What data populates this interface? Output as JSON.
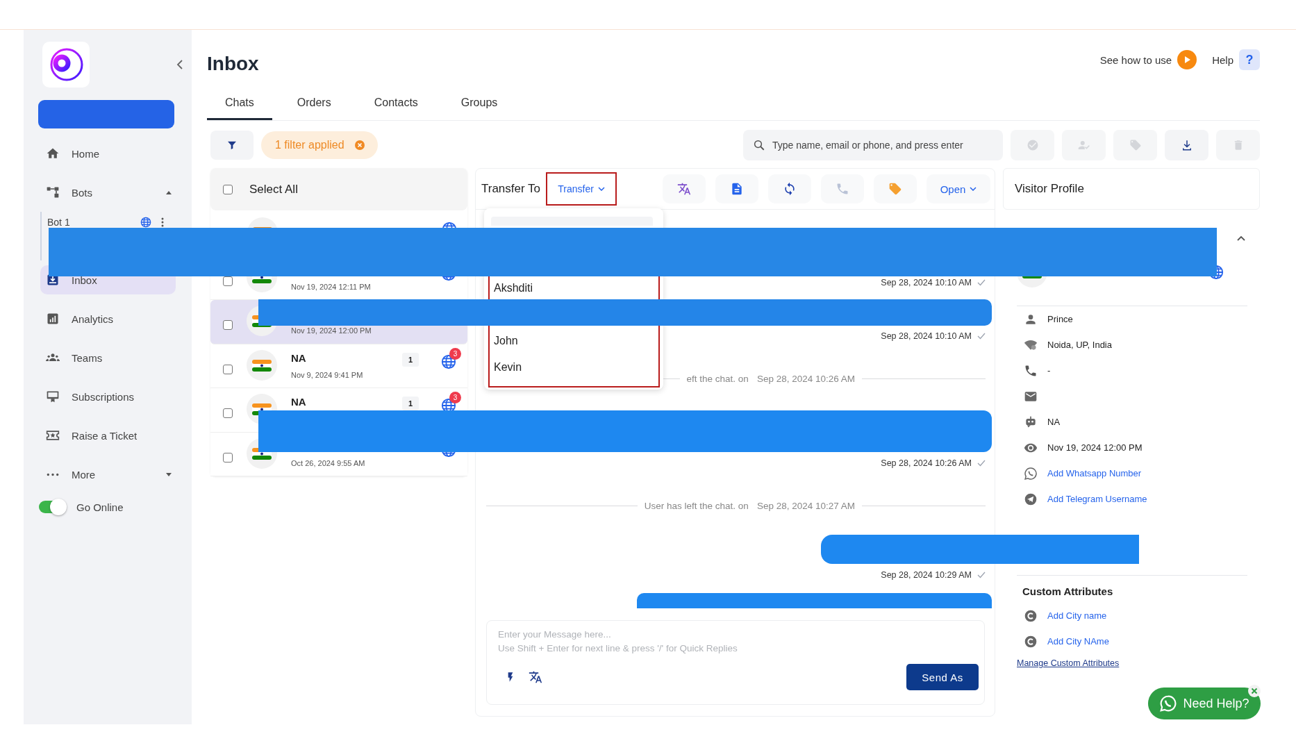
{
  "sidebar": {
    "items": [
      {
        "label": "Home",
        "selected": false
      },
      {
        "label": "Bots",
        "selected": false,
        "expanded": true,
        "children": [
          {
            "label": "Bot 1",
            "selected": false
          }
        ]
      },
      {
        "label": "Inbox",
        "selected": true
      },
      {
        "label": "Analytics",
        "selected": false
      },
      {
        "label": "Teams",
        "selected": false
      },
      {
        "label": "Subscriptions",
        "selected": false
      },
      {
        "label": "Raise a Ticket",
        "selected": false
      },
      {
        "label": "More",
        "selected": false,
        "expanded": false
      }
    ],
    "go_online": {
      "label": "Go Online",
      "on": true
    }
  },
  "header": {
    "title": "Inbox",
    "see_how": "See how to use",
    "help": "Help",
    "help_icon": "?"
  },
  "tabs": [
    {
      "label": "Chats",
      "selected": true
    },
    {
      "label": "Orders",
      "selected": false
    },
    {
      "label": "Contacts",
      "selected": false
    },
    {
      "label": "Groups",
      "selected": false
    }
  ],
  "filter": {
    "label": "1 filter applied"
  },
  "search": {
    "placeholder": "Type name, email or phone, and press enter"
  },
  "toolbar": [
    {
      "disabled": true
    },
    {
      "disabled": true
    },
    {
      "disabled": true
    },
    {
      "disabled": false
    },
    {
      "disabled": true
    }
  ],
  "chat_list": {
    "select_all": {
      "label": "Select All",
      "checked": false
    },
    "rows": [
      {
        "selected": false,
        "web": true
      },
      {
        "checked": false,
        "selected": false,
        "web": true,
        "date": "Nov 19, 2024 12:11 PM"
      },
      {
        "checked": false,
        "selected": true,
        "web": false,
        "date": "Nov 19, 2024 12:00 PM"
      },
      {
        "checked": false,
        "selected": false,
        "web": true,
        "name": "NA",
        "date": "Nov 9, 2024 9:41 PM",
        "count": "1",
        "badge": "3"
      },
      {
        "checked": false,
        "selected": false,
        "web": true,
        "name": "NA",
        "count": "1",
        "badge": "3"
      },
      {
        "checked": false,
        "selected": false,
        "web": true,
        "date": "Oct 26, 2024 9:55 AM"
      }
    ]
  },
  "chat": {
    "transfer_label": "Transfer To",
    "transfer_button": "Transfer",
    "actions": [
      {
        "disabled": false
      },
      {
        "disabled": false
      },
      {
        "disabled": false
      },
      {
        "disabled": true
      },
      {
        "disabled": false
      }
    ],
    "status_button": "Open",
    "transfer_menu": {
      "items": [
        "Akshditi",
        "John",
        "Kevin"
      ]
    },
    "messages": [
      {
        "kind": "sent",
        "time": "Sep 28, 2024 10:10 AM"
      },
      {
        "kind": "sent",
        "time": "Sep 28, 2024 10:10 AM"
      },
      {
        "kind": "system",
        "text": "eft the chat. on",
        "time": "Sep 28, 2024 10:26 AM"
      },
      {
        "kind": "sent",
        "time": "Sep 28, 2024 10:26 AM"
      },
      {
        "kind": "system",
        "text": "User has left the chat. on",
        "time": "Sep 28, 2024 10:27 AM"
      },
      {
        "kind": "sent",
        "time": "Sep 28, 2024 10:29 AM"
      }
    ],
    "composer": {
      "placeholder": "Enter your Message here...\nUse Shift + Enter for next line & press '/' for Quick Replies",
      "send": "Send As"
    }
  },
  "profile": {
    "title": "Visitor Profile",
    "expanded": true,
    "details": [
      {
        "kind": "text",
        "value": "Prince"
      },
      {
        "kind": "text",
        "value": "Noida, UP, India"
      },
      {
        "kind": "text",
        "value": "-"
      },
      {
        "kind": "text"
      },
      {
        "kind": "text",
        "value": "NA"
      },
      {
        "kind": "text",
        "value": "Nov 19, 2024 12:00 PM"
      },
      {
        "kind": "link",
        "value": "Add Whatsapp Number"
      },
      {
        "kind": "link",
        "value": "Add Telegram Username"
      }
    ],
    "custom_attributes": {
      "title": "Custom Attributes",
      "items": [
        "Add City name",
        "Add City NAme"
      ],
      "manage": "Manage Custom Attributes"
    }
  },
  "help_widget": {
    "label": "Need Help?"
  }
}
